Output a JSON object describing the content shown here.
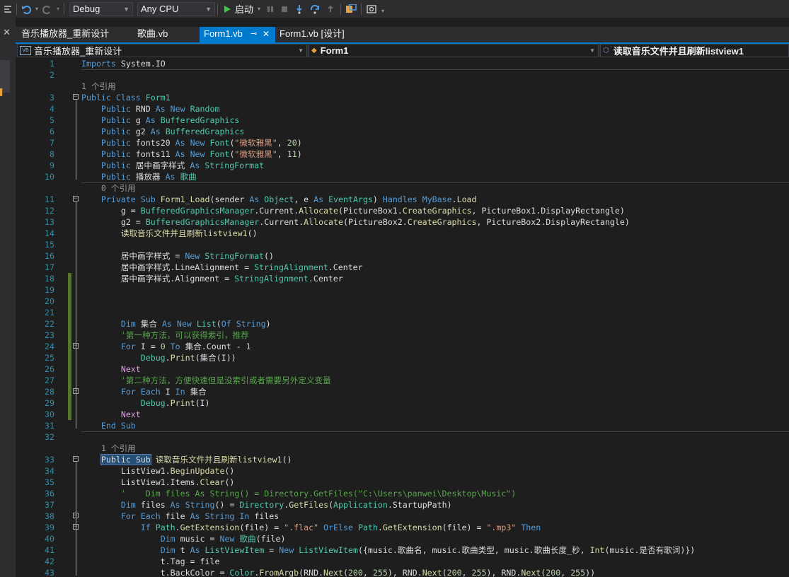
{
  "toolbar": {
    "config": "Debug",
    "platform": "Any CPU",
    "start_label": "启动"
  },
  "tabs": [
    {
      "label": "音乐播放器_重新设计",
      "active": false
    },
    {
      "label": "歌曲.vb",
      "active": false
    },
    {
      "label": "Form1.vb",
      "active": true
    },
    {
      "label": "Form1.vb [设计]",
      "active": false
    }
  ],
  "navbar": {
    "project": "音乐播放器_重新设计",
    "class": "Form1",
    "member": "读取音乐文件并且刷新listview1"
  },
  "code_lines": [
    {
      "n": "1",
      "t": [
        [
          "kw",
          "Imports"
        ],
        [
          "pl",
          " System.IO"
        ]
      ]
    },
    {
      "n": "2",
      "t": []
    },
    {
      "lens": "1 个引用",
      "indent": ""
    },
    {
      "n": "3",
      "t": [
        [
          "kw",
          "Public Class"
        ],
        [
          "pl",
          " "
        ],
        [
          "ty",
          "Form1"
        ]
      ]
    },
    {
      "n": "4",
      "t": [
        [
          "pl",
          "    "
        ],
        [
          "kw",
          "Public"
        ],
        [
          "pl",
          " RND "
        ],
        [
          "kw",
          "As New"
        ],
        [
          "pl",
          " "
        ],
        [
          "ty",
          "Random"
        ]
      ]
    },
    {
      "n": "5",
      "t": [
        [
          "pl",
          "    "
        ],
        [
          "kw",
          "Public"
        ],
        [
          "pl",
          " g "
        ],
        [
          "kw",
          "As"
        ],
        [
          "pl",
          " "
        ],
        [
          "ty",
          "BufferedGraphics"
        ]
      ]
    },
    {
      "n": "6",
      "t": [
        [
          "pl",
          "    "
        ],
        [
          "kw",
          "Public"
        ],
        [
          "pl",
          " g2 "
        ],
        [
          "kw",
          "As"
        ],
        [
          "pl",
          " "
        ],
        [
          "ty",
          "BufferedGraphics"
        ]
      ]
    },
    {
      "n": "7",
      "t": [
        [
          "pl",
          "    "
        ],
        [
          "kw",
          "Public"
        ],
        [
          "pl",
          " fonts20 "
        ],
        [
          "kw",
          "As New"
        ],
        [
          "pl",
          " "
        ],
        [
          "ty",
          "Font"
        ],
        [
          "pl",
          "("
        ],
        [
          "st",
          "\"微软雅黑\""
        ],
        [
          "pl",
          ", "
        ],
        [
          "nu",
          "20"
        ],
        [
          "pl",
          ")"
        ]
      ]
    },
    {
      "n": "8",
      "t": [
        [
          "pl",
          "    "
        ],
        [
          "kw",
          "Public"
        ],
        [
          "pl",
          " fonts11 "
        ],
        [
          "kw",
          "As New"
        ],
        [
          "pl",
          " "
        ],
        [
          "ty",
          "Font"
        ],
        [
          "pl",
          "("
        ],
        [
          "st",
          "\"微软雅黑\""
        ],
        [
          "pl",
          ", "
        ],
        [
          "nu",
          "11"
        ],
        [
          "pl",
          ")"
        ]
      ]
    },
    {
      "n": "9",
      "t": [
        [
          "pl",
          "    "
        ],
        [
          "kw",
          "Public"
        ],
        [
          "pl",
          " 居中画字样式 "
        ],
        [
          "kw",
          "As"
        ],
        [
          "pl",
          " "
        ],
        [
          "ty",
          "StringFormat"
        ]
      ]
    },
    {
      "n": "10",
      "t": [
        [
          "pl",
          "    "
        ],
        [
          "kw",
          "Public"
        ],
        [
          "pl",
          " 播放器 "
        ],
        [
          "kw",
          "As"
        ],
        [
          "pl",
          " "
        ],
        [
          "ty",
          "歌曲"
        ]
      ]
    },
    {
      "lens": "0 个引用",
      "indent": "    "
    },
    {
      "n": "11",
      "t": [
        [
          "pl",
          "    "
        ],
        [
          "kw",
          "Private Sub"
        ],
        [
          "pl",
          " "
        ],
        [
          "fn",
          "Form1_Load"
        ],
        [
          "pl",
          "(sender "
        ],
        [
          "kw",
          "As"
        ],
        [
          "pl",
          " "
        ],
        [
          "ty",
          "Object"
        ],
        [
          "pl",
          ", e "
        ],
        [
          "kw",
          "As"
        ],
        [
          "pl",
          " "
        ],
        [
          "ty",
          "EventArgs"
        ],
        [
          "pl",
          ") "
        ],
        [
          "kw",
          "Handles"
        ],
        [
          "pl",
          " "
        ],
        [
          "kw",
          "MyBase"
        ],
        [
          "pl",
          "."
        ],
        [
          "fn",
          "Load"
        ]
      ]
    },
    {
      "n": "12",
      "t": [
        [
          "pl",
          "        g = "
        ],
        [
          "ty",
          "BufferedGraphicsManager"
        ],
        [
          "pl",
          "."
        ],
        [
          "pl",
          "Current"
        ],
        [
          "pl",
          "."
        ],
        [
          "fn",
          "Allocate"
        ],
        [
          "pl",
          "(PictureBox1."
        ],
        [
          "fn",
          "CreateGraphics"
        ],
        [
          "pl",
          ", PictureBox1.DisplayRectangle)"
        ]
      ]
    },
    {
      "n": "13",
      "t": [
        [
          "pl",
          "        g2 = "
        ],
        [
          "ty",
          "BufferedGraphicsManager"
        ],
        [
          "pl",
          "."
        ],
        [
          "pl",
          "Current"
        ],
        [
          "pl",
          "."
        ],
        [
          "fn",
          "Allocate"
        ],
        [
          "pl",
          "(PictureBox2."
        ],
        [
          "fn",
          "CreateGraphics"
        ],
        [
          "pl",
          ", PictureBox2.DisplayRectangle)"
        ]
      ]
    },
    {
      "n": "14",
      "t": [
        [
          "pl",
          "        "
        ],
        [
          "fn",
          "读取音乐文件并且刷新listview1"
        ],
        [
          "pl",
          "()"
        ]
      ]
    },
    {
      "n": "15",
      "t": []
    },
    {
      "n": "16",
      "t": [
        [
          "pl",
          "        居中画字样式 = "
        ],
        [
          "kw",
          "New"
        ],
        [
          "pl",
          " "
        ],
        [
          "ty",
          "StringFormat"
        ],
        [
          "pl",
          "()"
        ]
      ]
    },
    {
      "n": "17",
      "t": [
        [
          "pl",
          "        居中画字样式.LineAlignment = "
        ],
        [
          "ty",
          "StringAlignment"
        ],
        [
          "pl",
          ".Center"
        ]
      ]
    },
    {
      "n": "18",
      "t": [
        [
          "pl",
          "        居中画字样式.Alignment = "
        ],
        [
          "ty",
          "StringAlignment"
        ],
        [
          "pl",
          ".Center"
        ]
      ]
    },
    {
      "n": "19",
      "t": []
    },
    {
      "n": "20",
      "t": []
    },
    {
      "n": "21",
      "t": []
    },
    {
      "n": "22",
      "t": [
        [
          "pl",
          "        "
        ],
        [
          "kw",
          "Dim"
        ],
        [
          "pl",
          " 集合 "
        ],
        [
          "kw",
          "As New"
        ],
        [
          "pl",
          " "
        ],
        [
          "ty",
          "List"
        ],
        [
          "pl",
          "("
        ],
        [
          "kw",
          "Of"
        ],
        [
          "pl",
          " "
        ],
        [
          "kw",
          "String"
        ],
        [
          "pl",
          ")"
        ]
      ]
    },
    {
      "n": "23",
      "t": [
        [
          "pl",
          "        "
        ],
        [
          "cm",
          "'第一种方法，可以获得索引，推荐"
        ]
      ]
    },
    {
      "n": "24",
      "t": [
        [
          "pl",
          "        "
        ],
        [
          "kw",
          "For"
        ],
        [
          "pl",
          " I = "
        ],
        [
          "nu",
          "0"
        ],
        [
          "pl",
          " "
        ],
        [
          "kw",
          "To"
        ],
        [
          "pl",
          " 集合.Count - "
        ],
        [
          "nu",
          "1"
        ]
      ]
    },
    {
      "n": "25",
      "t": [
        [
          "pl",
          "            "
        ],
        [
          "ty",
          "Debug"
        ],
        [
          "pl",
          "."
        ],
        [
          "fn",
          "Print"
        ],
        [
          "pl",
          "(集合(I))"
        ]
      ]
    },
    {
      "n": "26",
      "t": [
        [
          "pl",
          "        "
        ],
        [
          "ct",
          "Next"
        ]
      ]
    },
    {
      "n": "27",
      "t": [
        [
          "pl",
          "        "
        ],
        [
          "cm",
          "'第二种方法，方便快速但是没索引或者需要另外定义变量"
        ]
      ]
    },
    {
      "n": "28",
      "t": [
        [
          "pl",
          "        "
        ],
        [
          "kw",
          "For Each"
        ],
        [
          "pl",
          " I "
        ],
        [
          "kw",
          "In"
        ],
        [
          "pl",
          " 集合"
        ]
      ]
    },
    {
      "n": "29",
      "t": [
        [
          "pl",
          "            "
        ],
        [
          "ty",
          "Debug"
        ],
        [
          "pl",
          "."
        ],
        [
          "fn",
          "Print"
        ],
        [
          "pl",
          "(I)"
        ]
      ]
    },
    {
      "n": "30",
      "t": [
        [
          "pl",
          "        "
        ],
        [
          "ct",
          "Next"
        ]
      ]
    },
    {
      "n": "31",
      "t": [
        [
          "pl",
          "    "
        ],
        [
          "kw",
          "End Sub"
        ]
      ]
    },
    {
      "n": "32",
      "t": []
    },
    {
      "lens": "1 个引用",
      "indent": "    "
    },
    {
      "n": "33",
      "t": [
        [
          "pl",
          "    "
        ],
        [
          "sel",
          "Public Sub"
        ],
        [
          "pl",
          " "
        ],
        [
          "fn",
          "读取音乐文件并且刷新listview1"
        ],
        [
          "pl",
          "()"
        ]
      ]
    },
    {
      "n": "34",
      "t": [
        [
          "pl",
          "        ListView1."
        ],
        [
          "fn",
          "BeginUpdate"
        ],
        [
          "pl",
          "()"
        ]
      ]
    },
    {
      "n": "35",
      "t": [
        [
          "pl",
          "        ListView1.Items."
        ],
        [
          "fn",
          "Clear"
        ],
        [
          "pl",
          "()"
        ]
      ]
    },
    {
      "n": "36",
      "t": [
        [
          "pl",
          "        "
        ],
        [
          "cm",
          "'    Dim files As String() = Directory.GetFiles(\"C:\\Users\\panwei\\Desktop\\Music\")"
        ]
      ]
    },
    {
      "n": "37",
      "t": [
        [
          "pl",
          "        "
        ],
        [
          "kw",
          "Dim"
        ],
        [
          "pl",
          " files "
        ],
        [
          "kw",
          "As String"
        ],
        [
          "pl",
          "() = "
        ],
        [
          "ty",
          "Directory"
        ],
        [
          "pl",
          "."
        ],
        [
          "fn",
          "GetFiles"
        ],
        [
          "pl",
          "("
        ],
        [
          "ty",
          "Application"
        ],
        [
          "pl",
          ".StartupPath)"
        ]
      ]
    },
    {
      "n": "38",
      "t": [
        [
          "pl",
          "        "
        ],
        [
          "kw",
          "For Each"
        ],
        [
          "pl",
          " file "
        ],
        [
          "kw",
          "As String"
        ],
        [
          "pl",
          " "
        ],
        [
          "kw",
          "In"
        ],
        [
          "pl",
          " files"
        ]
      ]
    },
    {
      "n": "39",
      "t": [
        [
          "pl",
          "            "
        ],
        [
          "kw",
          "If"
        ],
        [
          "pl",
          " "
        ],
        [
          "ty",
          "Path"
        ],
        [
          "pl",
          "."
        ],
        [
          "fn",
          "GetExtension"
        ],
        [
          "pl",
          "(file) = "
        ],
        [
          "st",
          "\".flac\""
        ],
        [
          "pl",
          " "
        ],
        [
          "kw",
          "OrElse"
        ],
        [
          "pl",
          " "
        ],
        [
          "ty",
          "Path"
        ],
        [
          "pl",
          "."
        ],
        [
          "fn",
          "GetExtension"
        ],
        [
          "pl",
          "(file) = "
        ],
        [
          "st",
          "\".mp3\""
        ],
        [
          "pl",
          " "
        ],
        [
          "kw",
          "Then"
        ]
      ]
    },
    {
      "n": "40",
      "t": [
        [
          "pl",
          "                "
        ],
        [
          "kw",
          "Dim"
        ],
        [
          "pl",
          " music = "
        ],
        [
          "kw",
          "New"
        ],
        [
          "pl",
          " "
        ],
        [
          "ty",
          "歌曲"
        ],
        [
          "pl",
          "(file)"
        ]
      ]
    },
    {
      "n": "41",
      "t": [
        [
          "pl",
          "                "
        ],
        [
          "kw",
          "Dim"
        ],
        [
          "pl",
          " t "
        ],
        [
          "kw",
          "As"
        ],
        [
          "pl",
          " "
        ],
        [
          "ty",
          "ListViewItem"
        ],
        [
          "pl",
          " = "
        ],
        [
          "kw",
          "New"
        ],
        [
          "pl",
          " "
        ],
        [
          "ty",
          "ListViewItem"
        ],
        [
          "pl",
          "({music.歌曲名, music.歌曲类型, music.歌曲长度_秒, "
        ],
        [
          "fn",
          "Int"
        ],
        [
          "pl",
          "(music.是否有歌词)})"
        ]
      ]
    },
    {
      "n": "42",
      "t": [
        [
          "pl",
          "                t.Tag = file"
        ]
      ]
    },
    {
      "n": "43",
      "t": [
        [
          "pl",
          "                t.BackColor = "
        ],
        [
          "ty",
          "Color"
        ],
        [
          "pl",
          "."
        ],
        [
          "fn",
          "FromArgb"
        ],
        [
          "pl",
          "(RND."
        ],
        [
          "fn",
          "Next"
        ],
        [
          "pl",
          "("
        ],
        [
          "nu",
          "200"
        ],
        [
          "pl",
          ", "
        ],
        [
          "nu",
          "255"
        ],
        [
          "pl",
          "), RND."
        ],
        [
          "fn",
          "Next"
        ],
        [
          "pl",
          "("
        ],
        [
          "nu",
          "200"
        ],
        [
          "pl",
          ", "
        ],
        [
          "nu",
          "255"
        ],
        [
          "pl",
          "), RND."
        ],
        [
          "fn",
          "Next"
        ],
        [
          "pl",
          "("
        ],
        [
          "nu",
          "200"
        ],
        [
          "pl",
          ", "
        ],
        [
          "nu",
          "255"
        ],
        [
          "pl",
          "))"
        ]
      ]
    }
  ]
}
